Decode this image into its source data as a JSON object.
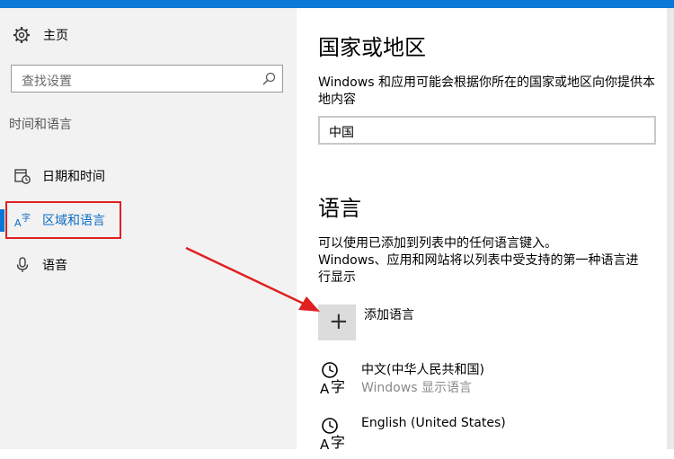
{
  "sidebar": {
    "home_label": "主页",
    "search_placeholder": "查找设置",
    "section_heading": "时间和语言",
    "items": [
      {
        "label": "日期和时间"
      },
      {
        "label": "区域和语言"
      },
      {
        "label": "语音"
      }
    ]
  },
  "main": {
    "region_heading": "国家或地区",
    "region_description": "Windows 和应用可能会根据你所在的国家或地区向你提供本地内容",
    "region_value": "中国",
    "language_heading": "语言",
    "language_description_1": "可以使用已添加到列表中的任何语言键入。",
    "language_description_2": "Windows、应用和网站将以列表中受支持的第一种语言进行显示",
    "add_language_label": "添加语言",
    "languages": [
      {
        "name": "中文(中华人民共和国)",
        "sub": "Windows 显示语言"
      },
      {
        "name": "English (United States)"
      }
    ]
  },
  "colors": {
    "accent": "#0b78d7",
    "annotation_red": "#e02020",
    "sidebar_bg": "#f2f2f2"
  },
  "icons": [
    "gear-icon",
    "search-icon",
    "calendar-clock-icon",
    "language-icon",
    "microphone-icon",
    "plus-icon",
    "language-pack-icon"
  ]
}
